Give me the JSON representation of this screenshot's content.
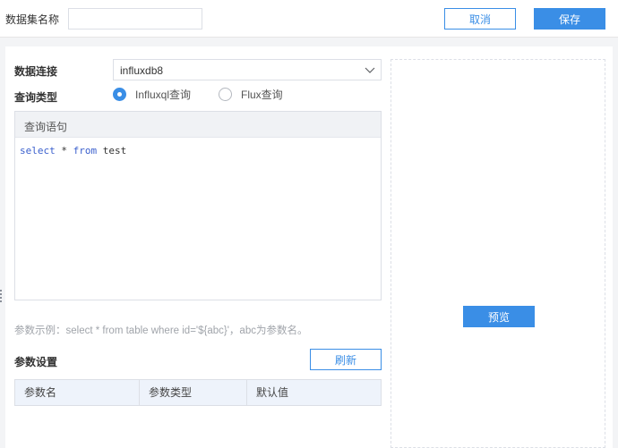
{
  "header": {
    "dataset_name_label": "数据集名称",
    "dataset_name_value": "",
    "cancel_label": "取消",
    "save_label": "保存"
  },
  "form": {
    "connection_label": "数据连接",
    "connection_value": "influxdb8",
    "query_type_label": "查询类型",
    "query_types": [
      {
        "label": "Influxql查询",
        "selected": true
      },
      {
        "label": "Flux查询",
        "selected": false
      }
    ],
    "editor_title": "查询语句",
    "query": {
      "kw_select": "select",
      "star": " * ",
      "kw_from": "from",
      "table": " test"
    },
    "hint": "参数示例：select * from table where id='${abc}'，abc为参数名。",
    "params_label": "参数设置",
    "refresh_label": "刷新",
    "param_columns": [
      "参数名",
      "参数类型",
      "默认值"
    ]
  },
  "preview": {
    "button_label": "预览"
  },
  "icons": {
    "select_arrow": "chevron-down-icon",
    "drag": "drag-handle-icon"
  },
  "colors": {
    "primary": "#3a8ee6",
    "table_header_bg": "#eef3fb"
  }
}
